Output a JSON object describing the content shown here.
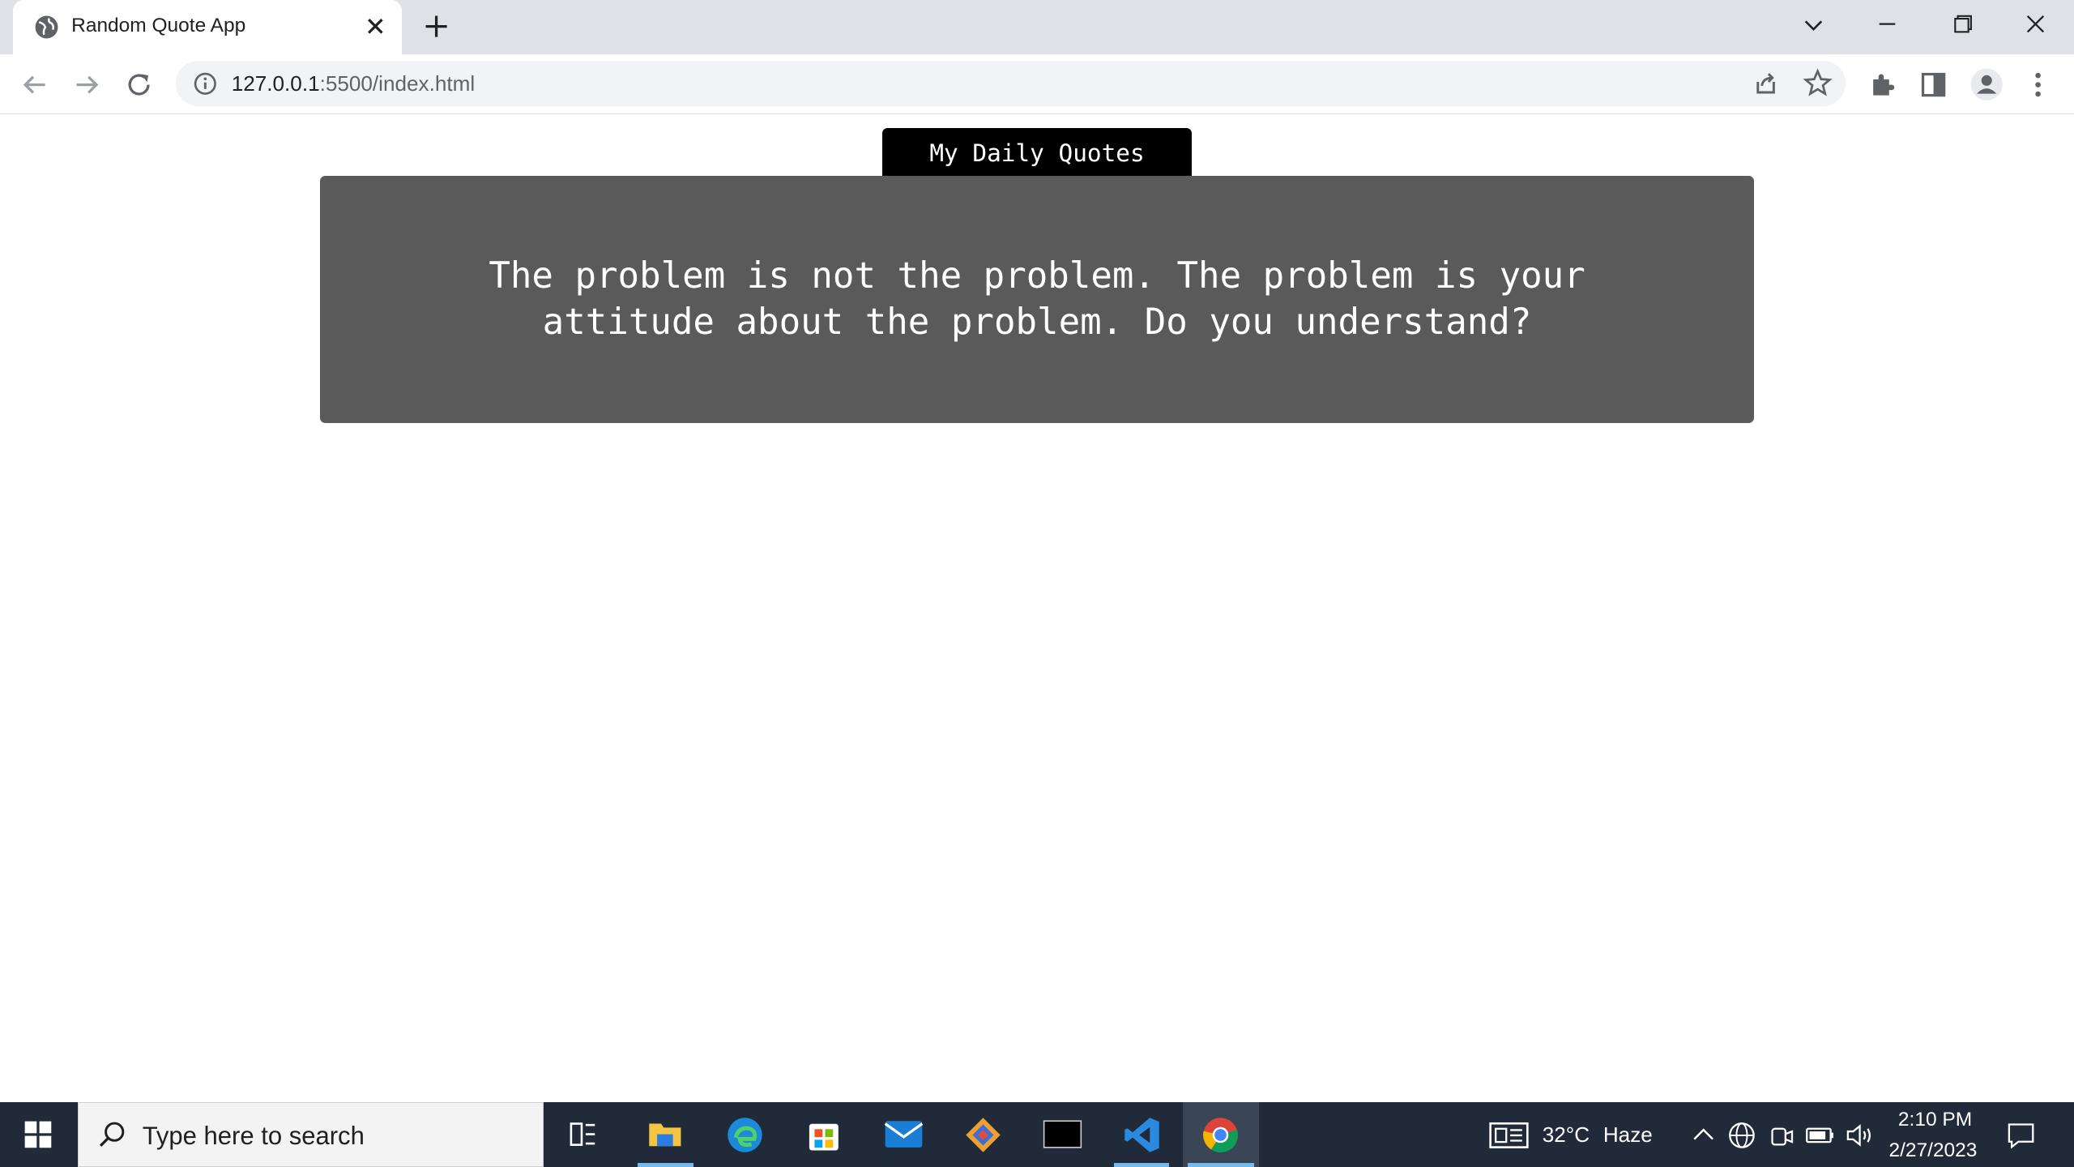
{
  "browser": {
    "tab_title": "Random Quote App",
    "url_host": "127.0.0.1",
    "url_rest": ":5500/index.html"
  },
  "page": {
    "header_label": "My Daily Quotes",
    "quote_line1": "The problem is not the problem. The problem is your",
    "quote_line2": "attitude about the problem. Do you understand?"
  },
  "taskbar": {
    "search_placeholder": "Type here to search",
    "weather_temp": "32°C",
    "weather_desc": "Haze",
    "time": "2:10 PM",
    "date": "2/27/2023"
  },
  "colors": {
    "tabstrip_bg": "#dee1e6",
    "card_bg": "#5a5a5a",
    "pill_bg": "#000000",
    "taskbar_bg": "#202a38"
  }
}
